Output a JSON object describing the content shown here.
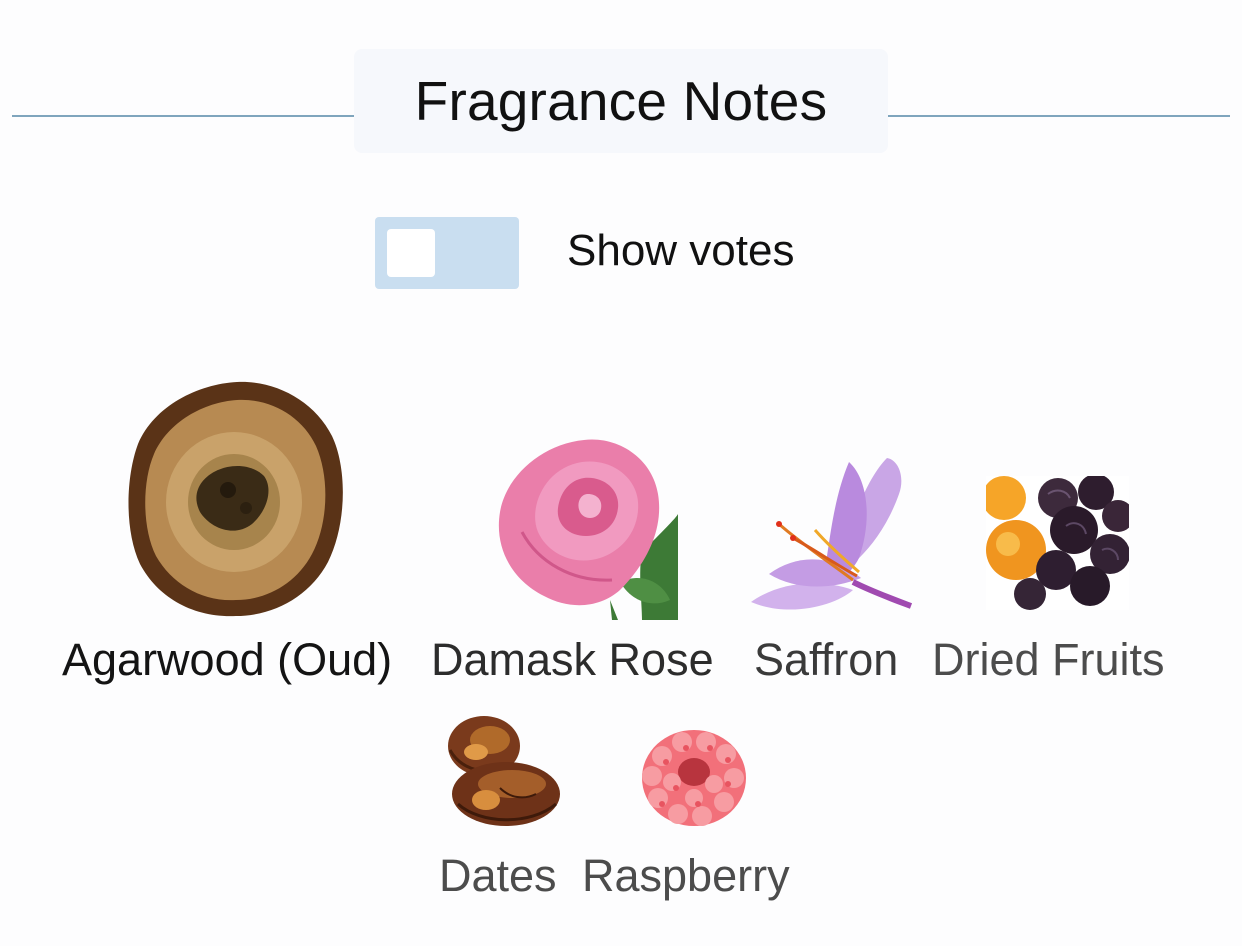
{
  "header": {
    "title": "Fragrance Notes"
  },
  "votes_toggle": {
    "label": "Show votes",
    "checked": false
  },
  "notes": [
    {
      "name": "Agarwood (Oud)",
      "icon": "agarwood-icon"
    },
    {
      "name": "Damask Rose",
      "icon": "rose-icon"
    },
    {
      "name": "Saffron",
      "icon": "saffron-icon"
    },
    {
      "name": "Dried Fruits",
      "icon": "dried-fruits-icon"
    },
    {
      "name": "Dates",
      "icon": "dates-icon"
    },
    {
      "name": "Raspberry",
      "icon": "raspberry-icon"
    }
  ]
}
